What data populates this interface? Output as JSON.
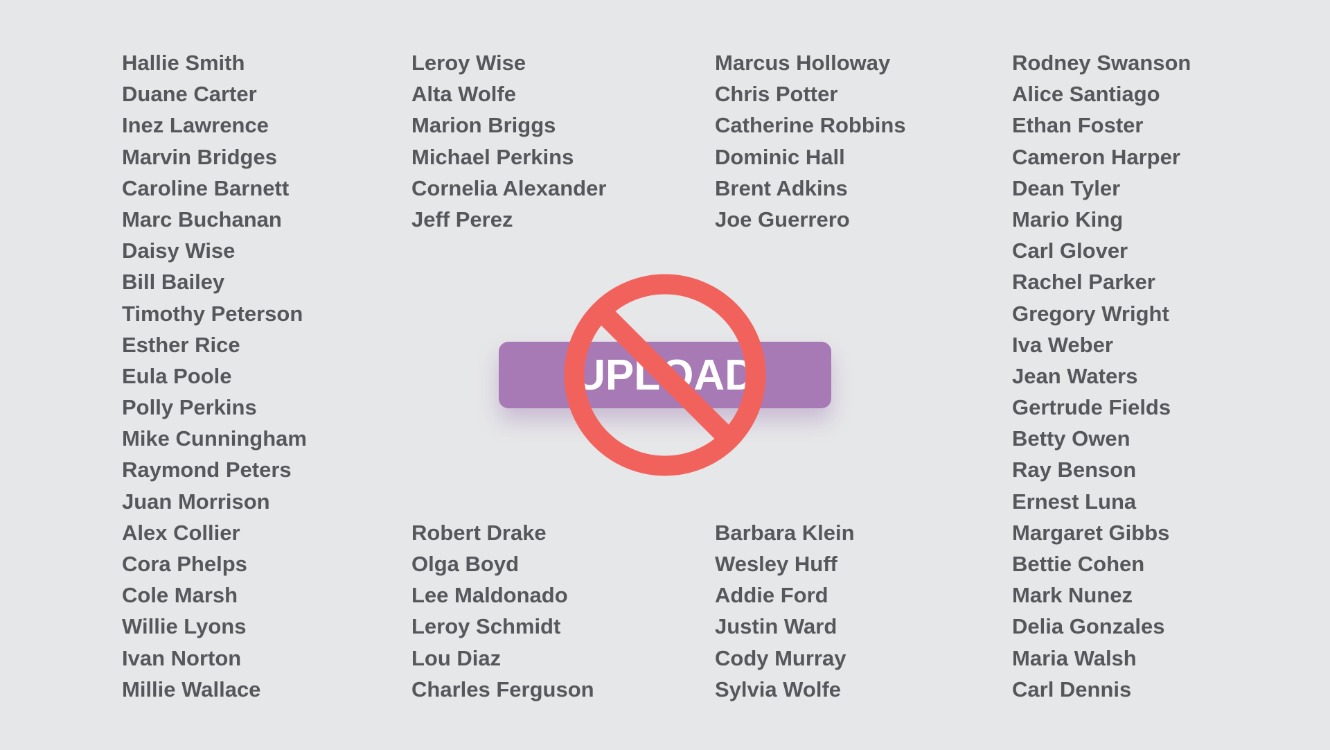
{
  "columns": [
    {
      "names": [
        "Hallie Smith",
        "Duane Carter",
        "Inez Lawrence",
        "Marvin Bridges",
        "Caroline Barnett",
        "Marc Buchanan",
        "Daisy Wise",
        "Bill Bailey",
        "Timothy Peterson",
        "Esther Rice",
        "Eula Poole",
        "Polly Perkins",
        "Mike Cunningham",
        "Raymond Peters",
        "Juan Morrison",
        "Alex Collier",
        "Cora Phelps",
        "Cole Marsh",
        "Willie Lyons",
        "Ivan Norton",
        "Millie Wallace"
      ]
    },
    {
      "top": [
        "Leroy Wise",
        "Alta Wolfe",
        "Marion Briggs",
        "Michael Perkins",
        "Cornelia Alexander",
        "Jeff Perez"
      ],
      "bottom": [
        "Robert Drake",
        "Olga Boyd",
        "Lee Maldonado",
        "Leroy Schmidt",
        "Lou Diaz",
        "Charles Ferguson"
      ]
    },
    {
      "top": [
        "Marcus Holloway",
        "Chris Potter",
        "Catherine Robbins",
        "Dominic Hall",
        "Brent Adkins",
        "Joe Guerrero"
      ],
      "bottom": [
        "Barbara Klein",
        "Wesley Huff",
        "Addie Ford",
        "Justin Ward",
        "Cody Murray",
        "Sylvia Wolfe"
      ]
    },
    {
      "names": [
        "Rodney Swanson",
        "Alice Santiago",
        "Ethan Foster",
        "Cameron Harper",
        "Dean Tyler",
        "Mario King",
        "Carl Glover",
        "Rachel Parker",
        "Gregory Wright",
        "Iva Weber",
        "Jean Waters",
        "Gertrude Fields",
        "Betty Owen",
        "Ray Benson",
        "Ernest Luna",
        "Margaret Gibbs",
        "Bettie Cohen",
        "Mark Nunez",
        "Delia Gonzales",
        "Maria Walsh",
        "Carl Dennis"
      ]
    }
  ],
  "upload_button": {
    "label": "UPLOAD"
  },
  "prohibition_icon": {
    "name": "no-sign-icon",
    "color": "#f2625c"
  },
  "colors": {
    "button": "#a77ab5",
    "text": "#56575b",
    "background": "#e6e7e9"
  }
}
